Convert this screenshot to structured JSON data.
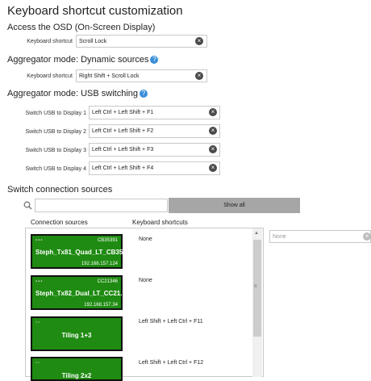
{
  "title": "Keyboard shortcut customization",
  "osd": {
    "heading": "Access the OSD (On-Screen Display)",
    "label": "Keyboard shortcut",
    "value": "Scroll Lock"
  },
  "dynamic": {
    "heading": "Aggregator mode: Dynamic sources",
    "label": "Keyboard shortcut",
    "value": "Right Shift + Scroll Lock"
  },
  "usb": {
    "heading": "Aggregator mode: USB switching",
    "rows": [
      {
        "label": "Switch USB to Display 1",
        "value": "Left Ctrl + Left Shift + F1"
      },
      {
        "label": "Switch USB to Display 2",
        "value": "Left Ctrl + Left Shift + F2"
      },
      {
        "label": "Switch USB to Display 3",
        "value": "Left Ctrl + Left Shift + F3"
      },
      {
        "label": "Switch USB to Display 4",
        "value": "Left Ctrl + Left Shift + F4"
      }
    ]
  },
  "sources": {
    "heading": "Switch connection sources",
    "search_placeholder": "",
    "show_all": "Show all",
    "col_sources": "Connection sources",
    "col_shortcuts": "Keyboard shortcuts",
    "side_placeholder": "None",
    "items": [
      {
        "name": "Steph_Tx81_Quad_LT_CB35...",
        "id": "CB35391",
        "ip": "192.168.157.124",
        "shortcut": "None"
      },
      {
        "name": "Steph_Tx82_Dual_LT_CC21...",
        "id": "CC21346",
        "ip": "192.168.157.34",
        "shortcut": "None"
      },
      {
        "name": "Tiling 1+3",
        "shortcut": "Left Shift + Left Ctrl + F11"
      },
      {
        "name": "Tiling 2x2",
        "shortcut": "Left Shift + Left Ctrl + F12"
      }
    ]
  },
  "colors": {
    "tile_green": "#1f8b12",
    "accent_blue": "#3b8fd9",
    "button_gray": "#a6a6a6"
  }
}
